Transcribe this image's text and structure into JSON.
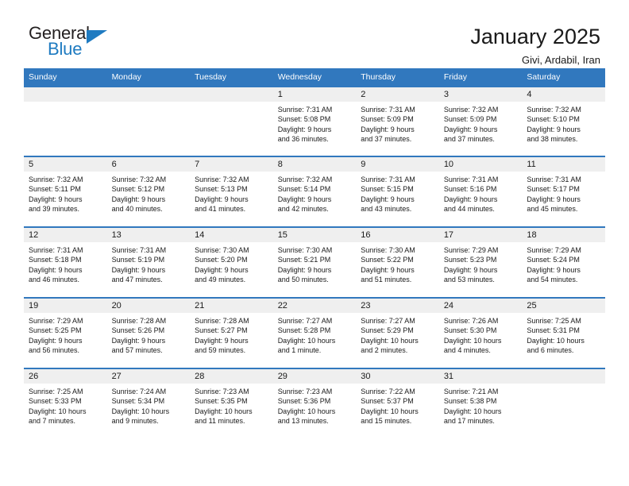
{
  "logo": {
    "word_top": "General",
    "word_bottom": "Blue",
    "triangle_icon": "blue-triangle-icon",
    "accent_color": "#1f7bc1"
  },
  "header": {
    "title": "January 2025",
    "subtitle": "Givi, Ardabil, Iran"
  },
  "theme": {
    "header_blue": "#3178be",
    "daynum_band": "#efefef",
    "text": "#1a1a1a"
  },
  "weekday_headers": [
    "Sunday",
    "Monday",
    "Tuesday",
    "Wednesday",
    "Thursday",
    "Friday",
    "Saturday"
  ],
  "weeks": [
    [
      {
        "day": "",
        "sunrise": "",
        "sunset": "",
        "daylight1": "",
        "daylight2": ""
      },
      {
        "day": "",
        "sunrise": "",
        "sunset": "",
        "daylight1": "",
        "daylight2": ""
      },
      {
        "day": "",
        "sunrise": "",
        "sunset": "",
        "daylight1": "",
        "daylight2": ""
      },
      {
        "day": "1",
        "sunrise": "Sunrise: 7:31 AM",
        "sunset": "Sunset: 5:08 PM",
        "daylight1": "Daylight: 9 hours",
        "daylight2": "and 36 minutes."
      },
      {
        "day": "2",
        "sunrise": "Sunrise: 7:31 AM",
        "sunset": "Sunset: 5:09 PM",
        "daylight1": "Daylight: 9 hours",
        "daylight2": "and 37 minutes."
      },
      {
        "day": "3",
        "sunrise": "Sunrise: 7:32 AM",
        "sunset": "Sunset: 5:09 PM",
        "daylight1": "Daylight: 9 hours",
        "daylight2": "and 37 minutes."
      },
      {
        "day": "4",
        "sunrise": "Sunrise: 7:32 AM",
        "sunset": "Sunset: 5:10 PM",
        "daylight1": "Daylight: 9 hours",
        "daylight2": "and 38 minutes."
      }
    ],
    [
      {
        "day": "5",
        "sunrise": "Sunrise: 7:32 AM",
        "sunset": "Sunset: 5:11 PM",
        "daylight1": "Daylight: 9 hours",
        "daylight2": "and 39 minutes."
      },
      {
        "day": "6",
        "sunrise": "Sunrise: 7:32 AM",
        "sunset": "Sunset: 5:12 PM",
        "daylight1": "Daylight: 9 hours",
        "daylight2": "and 40 minutes."
      },
      {
        "day": "7",
        "sunrise": "Sunrise: 7:32 AM",
        "sunset": "Sunset: 5:13 PM",
        "daylight1": "Daylight: 9 hours",
        "daylight2": "and 41 minutes."
      },
      {
        "day": "8",
        "sunrise": "Sunrise: 7:32 AM",
        "sunset": "Sunset: 5:14 PM",
        "daylight1": "Daylight: 9 hours",
        "daylight2": "and 42 minutes."
      },
      {
        "day": "9",
        "sunrise": "Sunrise: 7:31 AM",
        "sunset": "Sunset: 5:15 PM",
        "daylight1": "Daylight: 9 hours",
        "daylight2": "and 43 minutes."
      },
      {
        "day": "10",
        "sunrise": "Sunrise: 7:31 AM",
        "sunset": "Sunset: 5:16 PM",
        "daylight1": "Daylight: 9 hours",
        "daylight2": "and 44 minutes."
      },
      {
        "day": "11",
        "sunrise": "Sunrise: 7:31 AM",
        "sunset": "Sunset: 5:17 PM",
        "daylight1": "Daylight: 9 hours",
        "daylight2": "and 45 minutes."
      }
    ],
    [
      {
        "day": "12",
        "sunrise": "Sunrise: 7:31 AM",
        "sunset": "Sunset: 5:18 PM",
        "daylight1": "Daylight: 9 hours",
        "daylight2": "and 46 minutes."
      },
      {
        "day": "13",
        "sunrise": "Sunrise: 7:31 AM",
        "sunset": "Sunset: 5:19 PM",
        "daylight1": "Daylight: 9 hours",
        "daylight2": "and 47 minutes."
      },
      {
        "day": "14",
        "sunrise": "Sunrise: 7:30 AM",
        "sunset": "Sunset: 5:20 PM",
        "daylight1": "Daylight: 9 hours",
        "daylight2": "and 49 minutes."
      },
      {
        "day": "15",
        "sunrise": "Sunrise: 7:30 AM",
        "sunset": "Sunset: 5:21 PM",
        "daylight1": "Daylight: 9 hours",
        "daylight2": "and 50 minutes."
      },
      {
        "day": "16",
        "sunrise": "Sunrise: 7:30 AM",
        "sunset": "Sunset: 5:22 PM",
        "daylight1": "Daylight: 9 hours",
        "daylight2": "and 51 minutes."
      },
      {
        "day": "17",
        "sunrise": "Sunrise: 7:29 AM",
        "sunset": "Sunset: 5:23 PM",
        "daylight1": "Daylight: 9 hours",
        "daylight2": "and 53 minutes."
      },
      {
        "day": "18",
        "sunrise": "Sunrise: 7:29 AM",
        "sunset": "Sunset: 5:24 PM",
        "daylight1": "Daylight: 9 hours",
        "daylight2": "and 54 minutes."
      }
    ],
    [
      {
        "day": "19",
        "sunrise": "Sunrise: 7:29 AM",
        "sunset": "Sunset: 5:25 PM",
        "daylight1": "Daylight: 9 hours",
        "daylight2": "and 56 minutes."
      },
      {
        "day": "20",
        "sunrise": "Sunrise: 7:28 AM",
        "sunset": "Sunset: 5:26 PM",
        "daylight1": "Daylight: 9 hours",
        "daylight2": "and 57 minutes."
      },
      {
        "day": "21",
        "sunrise": "Sunrise: 7:28 AM",
        "sunset": "Sunset: 5:27 PM",
        "daylight1": "Daylight: 9 hours",
        "daylight2": "and 59 minutes."
      },
      {
        "day": "22",
        "sunrise": "Sunrise: 7:27 AM",
        "sunset": "Sunset: 5:28 PM",
        "daylight1": "Daylight: 10 hours",
        "daylight2": "and 1 minute."
      },
      {
        "day": "23",
        "sunrise": "Sunrise: 7:27 AM",
        "sunset": "Sunset: 5:29 PM",
        "daylight1": "Daylight: 10 hours",
        "daylight2": "and 2 minutes."
      },
      {
        "day": "24",
        "sunrise": "Sunrise: 7:26 AM",
        "sunset": "Sunset: 5:30 PM",
        "daylight1": "Daylight: 10 hours",
        "daylight2": "and 4 minutes."
      },
      {
        "day": "25",
        "sunrise": "Sunrise: 7:25 AM",
        "sunset": "Sunset: 5:31 PM",
        "daylight1": "Daylight: 10 hours",
        "daylight2": "and 6 minutes."
      }
    ],
    [
      {
        "day": "26",
        "sunrise": "Sunrise: 7:25 AM",
        "sunset": "Sunset: 5:33 PM",
        "daylight1": "Daylight: 10 hours",
        "daylight2": "and 7 minutes."
      },
      {
        "day": "27",
        "sunrise": "Sunrise: 7:24 AM",
        "sunset": "Sunset: 5:34 PM",
        "daylight1": "Daylight: 10 hours",
        "daylight2": "and 9 minutes."
      },
      {
        "day": "28",
        "sunrise": "Sunrise: 7:23 AM",
        "sunset": "Sunset: 5:35 PM",
        "daylight1": "Daylight: 10 hours",
        "daylight2": "and 11 minutes."
      },
      {
        "day": "29",
        "sunrise": "Sunrise: 7:23 AM",
        "sunset": "Sunset: 5:36 PM",
        "daylight1": "Daylight: 10 hours",
        "daylight2": "and 13 minutes."
      },
      {
        "day": "30",
        "sunrise": "Sunrise: 7:22 AM",
        "sunset": "Sunset: 5:37 PM",
        "daylight1": "Daylight: 10 hours",
        "daylight2": "and 15 minutes."
      },
      {
        "day": "31",
        "sunrise": "Sunrise: 7:21 AM",
        "sunset": "Sunset: 5:38 PM",
        "daylight1": "Daylight: 10 hours",
        "daylight2": "and 17 minutes."
      },
      {
        "day": "",
        "sunrise": "",
        "sunset": "",
        "daylight1": "",
        "daylight2": ""
      }
    ]
  ]
}
